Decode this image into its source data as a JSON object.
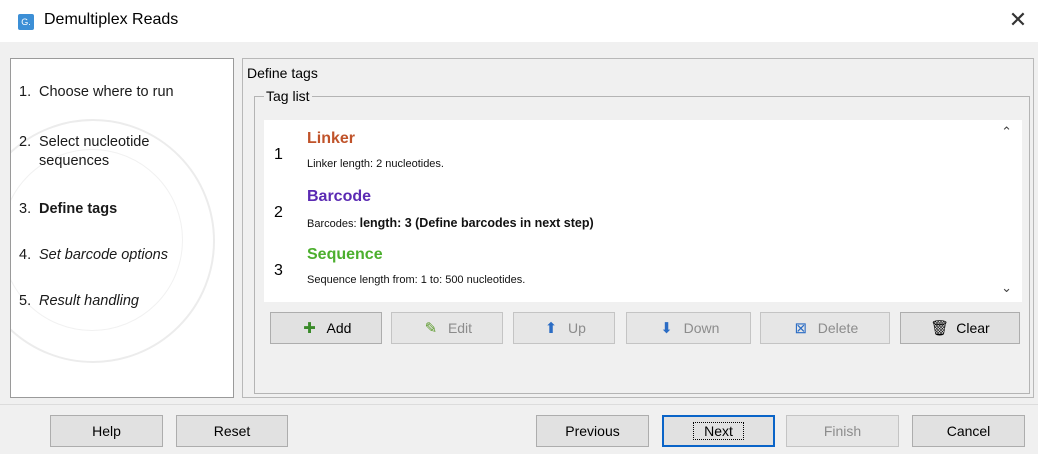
{
  "window": {
    "title": "Demultiplex Reads",
    "app_icon_text": "G.",
    "close_glyph": "✕"
  },
  "steps": [
    {
      "num": "1.",
      "label": "Choose where to run"
    },
    {
      "num": "2.",
      "label": "Select nucleotide sequences"
    },
    {
      "num": "3.",
      "label": "Define tags"
    },
    {
      "num": "4.",
      "label": "Set barcode options"
    },
    {
      "num": "5.",
      "label": "Result handling"
    }
  ],
  "main": {
    "title": "Define tags",
    "group_label": "Tag list",
    "tags": [
      {
        "num": "1",
        "name": "Linker",
        "color": "#c0532a",
        "desc": "Linker length: 2 nucleotides.",
        "desc_bold": ""
      },
      {
        "num": "2",
        "name": "Barcode",
        "color": "#5b2ab3",
        "desc": "Barcodes: ",
        "desc_bold": "length: 3 (Define barcodes in next step)"
      },
      {
        "num": "3",
        "name": "Sequence",
        "color": "#4caf2e",
        "desc": "Sequence length from: 1 to: 500 nucleotides.",
        "desc_bold": ""
      }
    ],
    "buttons": {
      "add": "Add",
      "edit": "Edit",
      "up": "Up",
      "down": "Down",
      "delete": "Delete",
      "clear": "Clear"
    }
  },
  "footer": {
    "help": "Help",
    "reset": "Reset",
    "previous": "Previous",
    "next": "Next",
    "finish": "Finish",
    "cancel": "Cancel"
  }
}
